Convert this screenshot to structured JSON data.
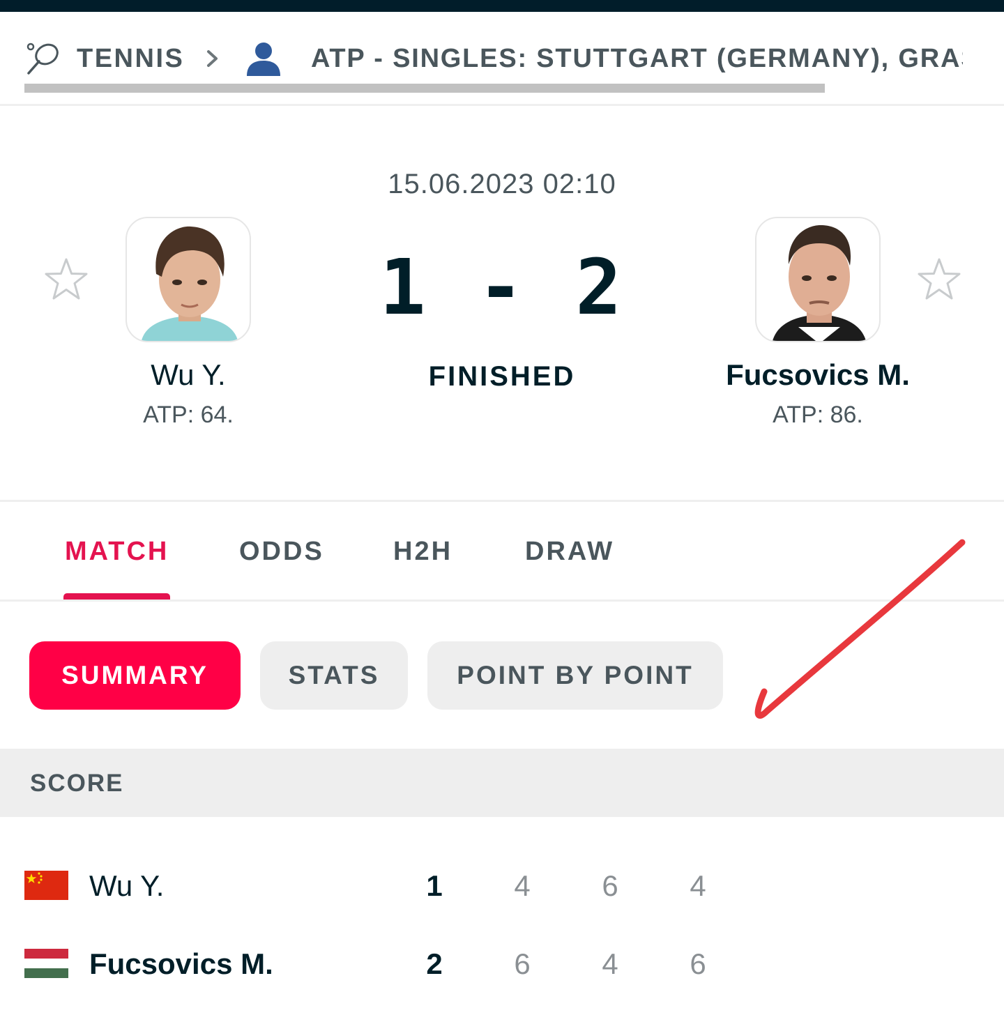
{
  "breadcrumb": {
    "sport": "TENNIS",
    "league": "ATP - SINGLES: STUTTGART (GERMANY), GRASS ·",
    "sport_icon": "tennis-racket-icon",
    "separator_icon": "chevron-right-icon",
    "category_icon": "person-icon"
  },
  "match": {
    "datetime": "15.06.2023 02:10",
    "score": "1 - 2",
    "status": "FINISHED",
    "home": {
      "name": "Wu Y.",
      "rank": "ATP: 64.",
      "favorite_icon": "star-outline-icon",
      "avatar": "player-photo"
    },
    "away": {
      "name": "Fucsovics M.",
      "rank": "ATP: 86.",
      "favorite_icon": "star-outline-icon",
      "avatar": "player-photo"
    }
  },
  "tabs": [
    {
      "label": "MATCH",
      "active": true
    },
    {
      "label": "ODDS",
      "active": false
    },
    {
      "label": "H2H",
      "active": false
    },
    {
      "label": "DRAW",
      "active": false
    }
  ],
  "subtabs": [
    {
      "label": "SUMMARY",
      "active": true
    },
    {
      "label": "STATS",
      "active": false
    },
    {
      "label": "POINT BY POINT",
      "active": false
    }
  ],
  "score_section": {
    "title": "SCORE",
    "rows": [
      {
        "player": "Wu Y.",
        "flag": "china-flag",
        "total": "1",
        "sets": [
          "4",
          "6",
          "4"
        ],
        "winner": false
      },
      {
        "player": "Fucsovics M.",
        "flag": "hungary-flag",
        "total": "2",
        "sets": [
          "6",
          "4",
          "6"
        ],
        "winner": true
      }
    ]
  },
  "colors": {
    "accent": "#ff0046",
    "accent_text": "#e4134f",
    "dark": "#001e28",
    "muted": "#4a565c",
    "annotation": "#e8383d"
  },
  "annotation_icon": "red-checkmark-icon"
}
